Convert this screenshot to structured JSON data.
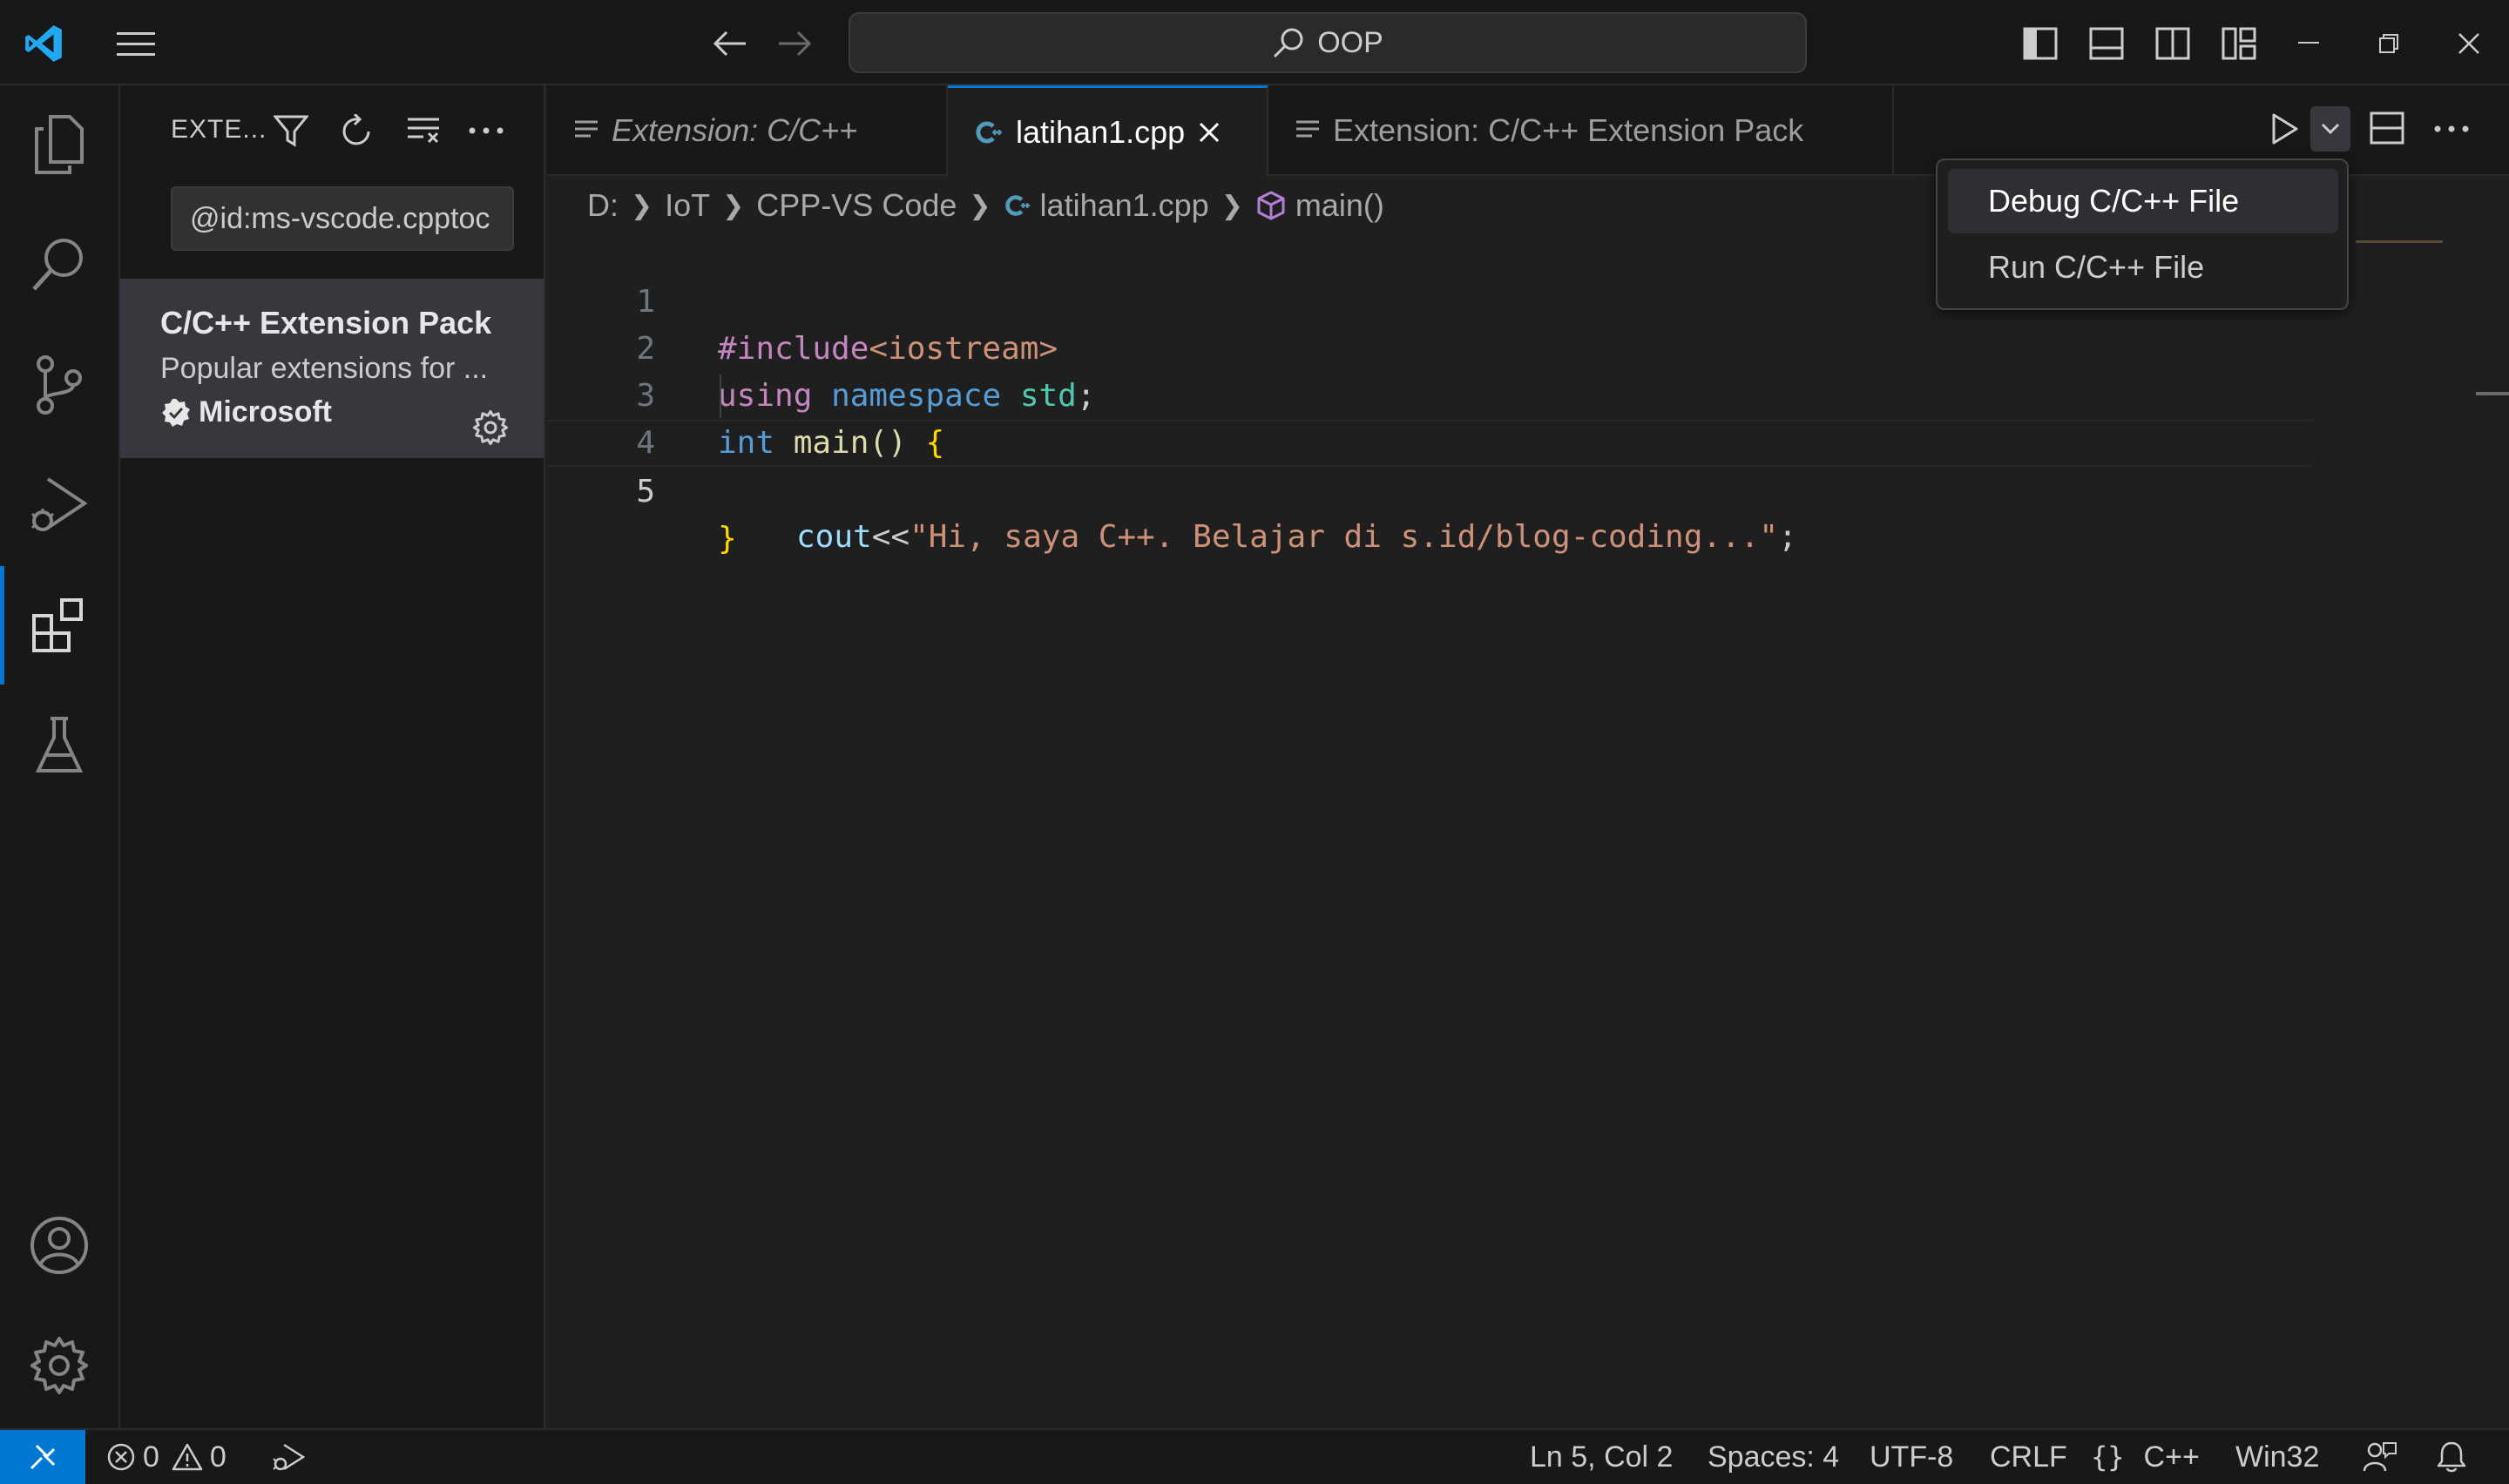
{
  "titlebar": {
    "command_center": "OOP"
  },
  "sidebar": {
    "title": "EXTE...",
    "search_value": "@id:ms-vscode.cpptoc",
    "extension": {
      "name": "C/C++ Extension Pack",
      "description": "Popular extensions for ...",
      "publisher": "Microsoft"
    }
  },
  "tabs": [
    {
      "label": "Extension: C/C++",
      "italic": true
    },
    {
      "label": "latihan1.cpp",
      "active": true
    },
    {
      "label": "Extension: C/C++ Extension Pack"
    }
  ],
  "breadcrumb": {
    "drive": "D:",
    "folder1": "IoT",
    "folder2": "CPP-VS Code",
    "file": "latihan1.cpp",
    "symbol": "main()"
  },
  "code": {
    "line_numbers": [
      "1",
      "2",
      "3",
      "4",
      "5"
    ],
    "l1_directive": "#include",
    "l1_header": "<iostream>",
    "l2_using": "using",
    "l2_namespace": "namespace",
    "l2_std": "std",
    "l2_semi": ";",
    "l3_int": "int",
    "l3_main": "main",
    "l3_parens": "() ",
    "l3_brace": "{",
    "l4_cout": "cout",
    "l4_op": "<<",
    "l4_string": "\"Hi, saya C++. Belajar di s.id/blog-coding...\"",
    "l4_semi": ";",
    "l5_brace": "}"
  },
  "run_menu": {
    "items": [
      "Debug C/C++ File",
      "Run C/C++ File"
    ]
  },
  "statusbar": {
    "errors": "0",
    "warnings": "0",
    "position": "Ln 5, Col 2",
    "spaces": "Spaces: 4",
    "encoding": "UTF-8",
    "eol": "CRLF",
    "language": "C++",
    "platform": "Win32"
  },
  "colors": {
    "accent": "#0078d4",
    "background": "#1f1f1f",
    "panel": "#181818",
    "brand_vscode": "#23a9f2"
  }
}
